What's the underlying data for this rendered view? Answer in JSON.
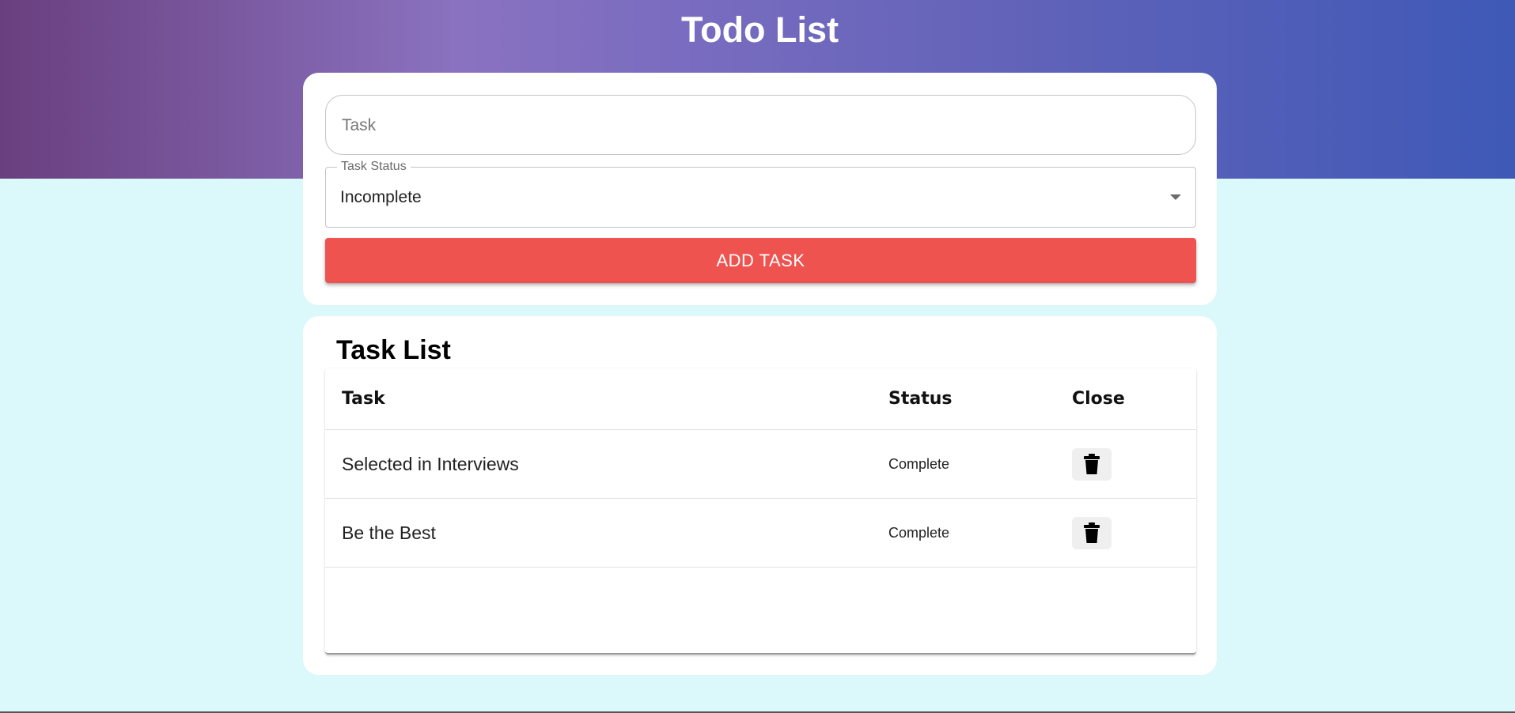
{
  "header": {
    "title": "Todo List"
  },
  "form": {
    "task_placeholder": "Task",
    "task_value": "",
    "status_label": "Task Status",
    "status_value": "Incomplete",
    "add_button_label": "ADD TASK"
  },
  "task_list": {
    "title": "Task List",
    "columns": [
      "Task",
      "Status",
      "Close"
    ],
    "rows": [
      {
        "task": "Selected in Interviews",
        "status": "Complete",
        "action_icon": "trash-icon"
      },
      {
        "task": "Be the Best",
        "status": "Complete",
        "action_icon": "trash-icon"
      }
    ]
  },
  "colors": {
    "page_background": "#dbf8fb",
    "header_gradient_start": "#6a3f7f",
    "header_gradient_end": "#3f59b7",
    "add_button": "#ef5350"
  }
}
